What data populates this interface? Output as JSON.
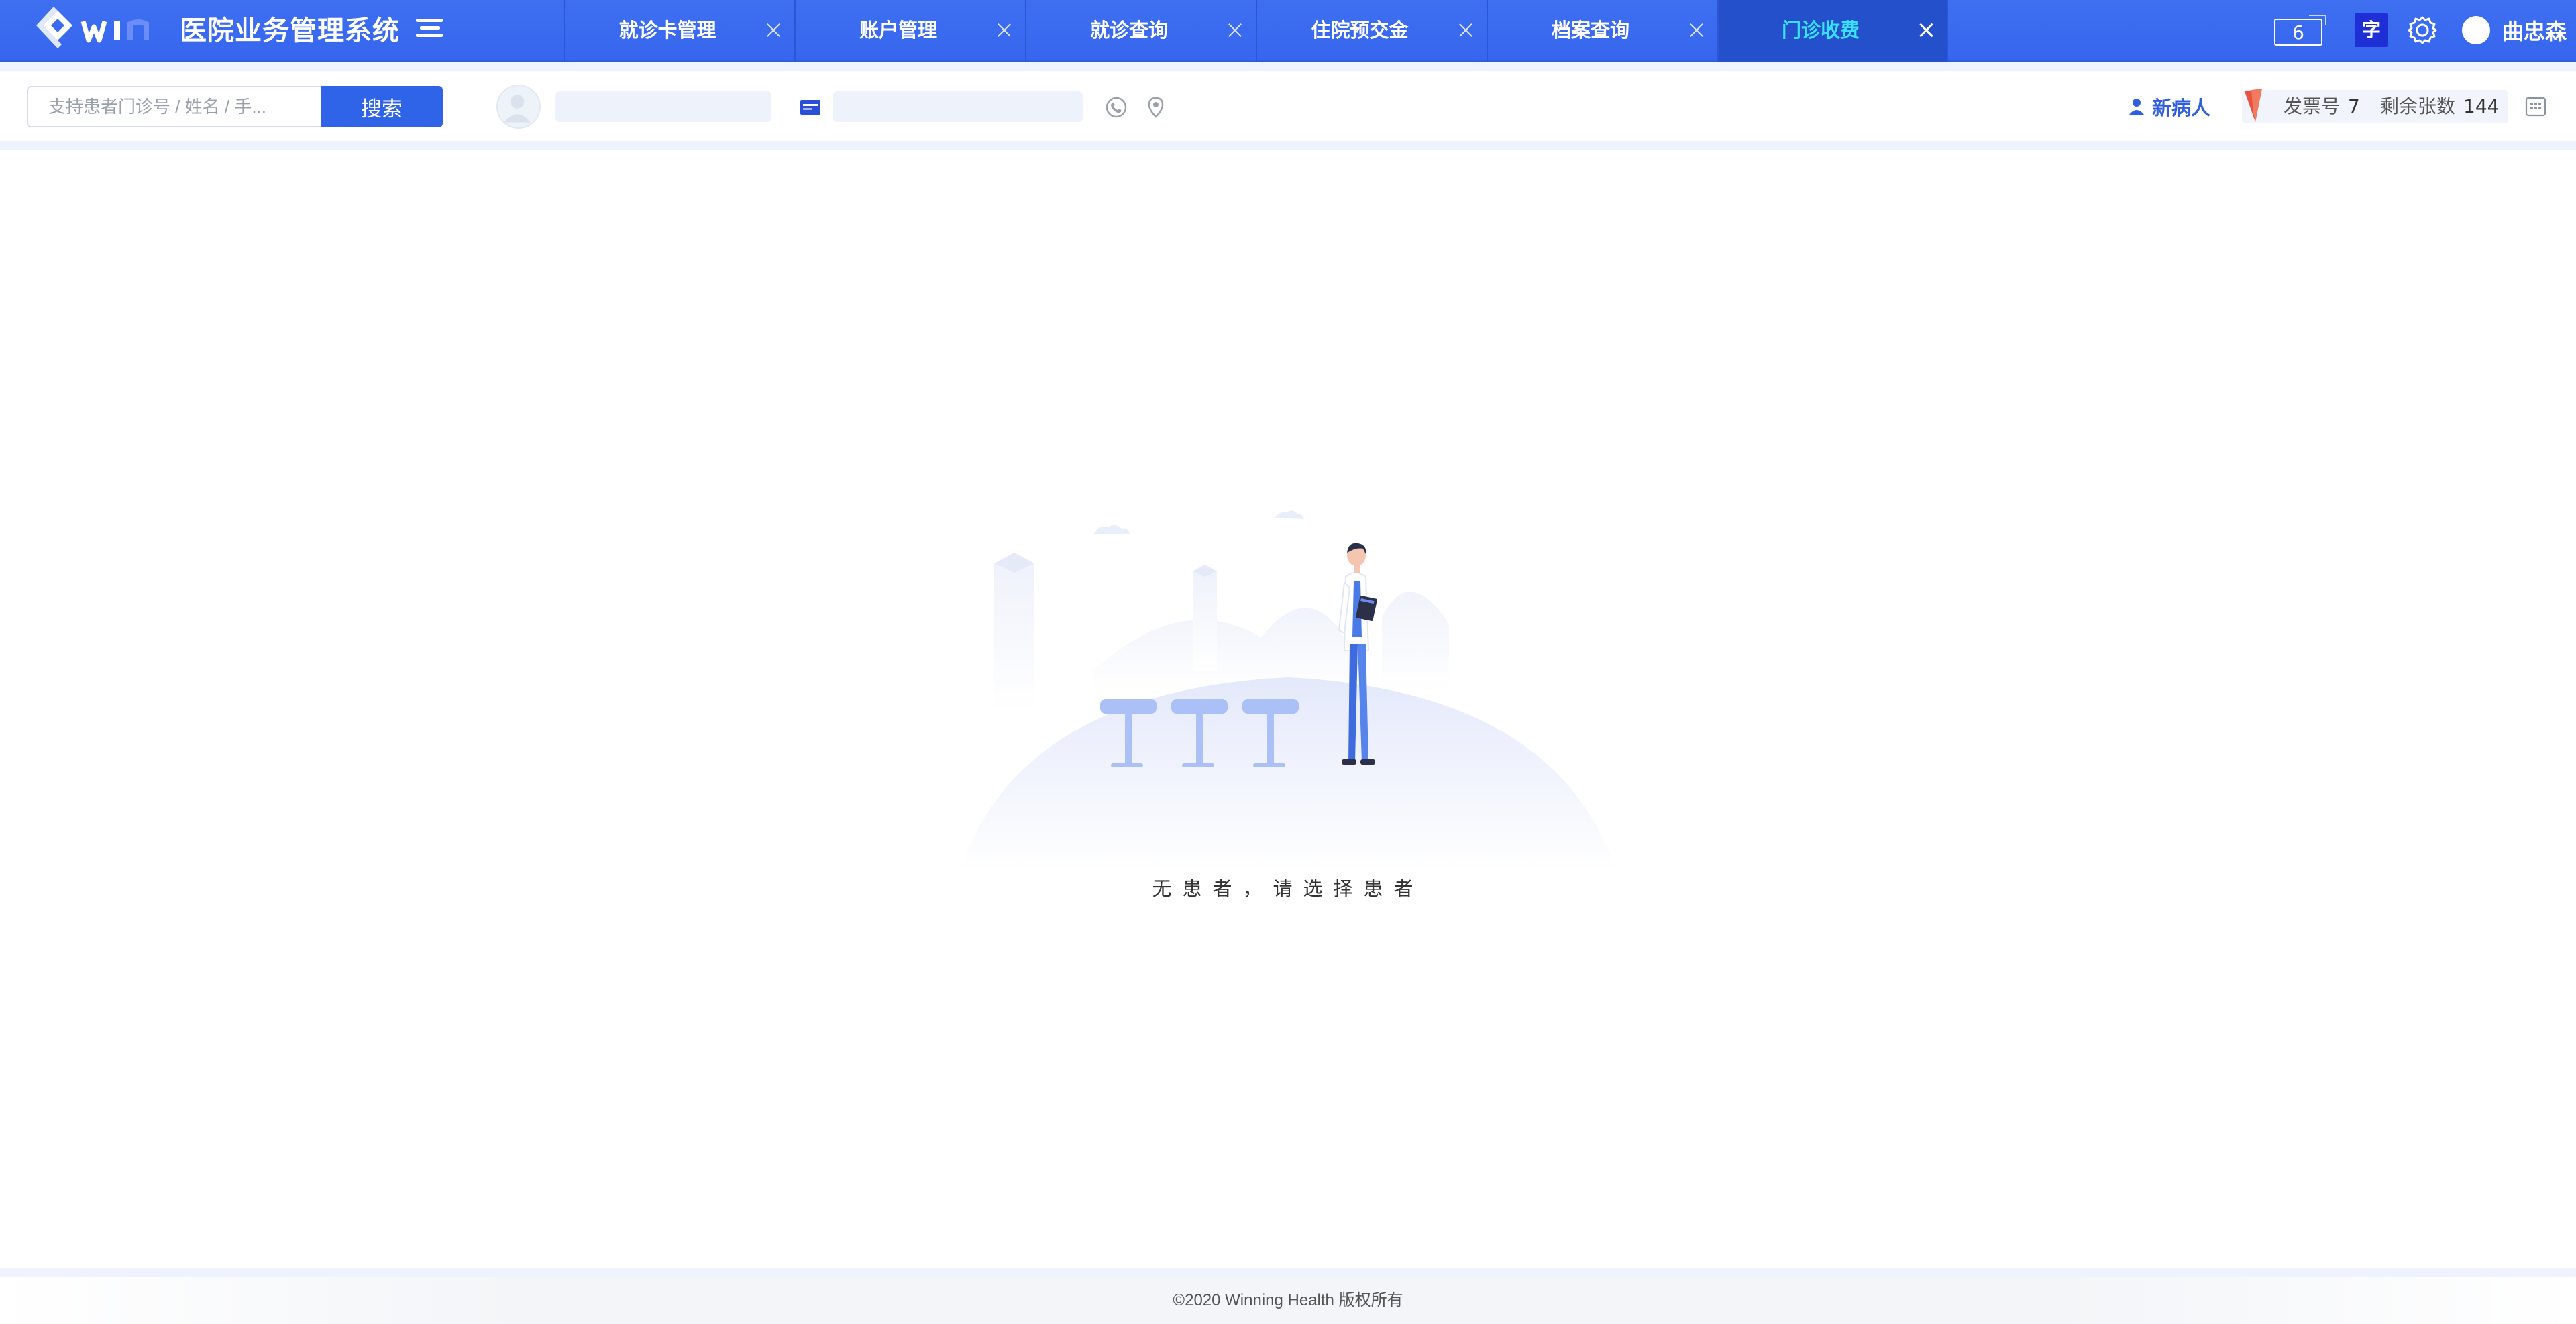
{
  "app": {
    "title": "医院业务管理系统",
    "brand_colors": {
      "primary": "#3566ee",
      "active_tab": "#2450cb",
      "active_tab_text": "#38e1ff"
    }
  },
  "tabs": [
    {
      "label": "就诊卡管理",
      "active": false
    },
    {
      "label": "账户管理",
      "active": false
    },
    {
      "label": "就诊查询",
      "active": false
    },
    {
      "label": "住院预交金",
      "active": false
    },
    {
      "label": "档案查询",
      "active": false
    },
    {
      "label": "门诊收费",
      "active": true
    }
  ],
  "header": {
    "message_count": "6",
    "font_button_label": "字",
    "user_name": "曲忠森",
    "icons": [
      "menu-icon",
      "message-icon",
      "gear-icon"
    ]
  },
  "search": {
    "placeholder": "支持患者门诊号 / 姓名 / 手...",
    "button_label": "搜索"
  },
  "patient_bar": {
    "new_patient_label": "新病人",
    "invoice_label": "发票号",
    "invoice_number": "7",
    "remaining_label": "剩余张数",
    "remaining_count": "144",
    "icons": [
      "avatar-icon",
      "card-icon",
      "phone-icon",
      "location-icon",
      "calculator-icon",
      "person-icon"
    ]
  },
  "empty_state": {
    "message": "无患者，请选择患者"
  },
  "footer": {
    "copyright": "©2020 Winning Health 版权所有"
  }
}
